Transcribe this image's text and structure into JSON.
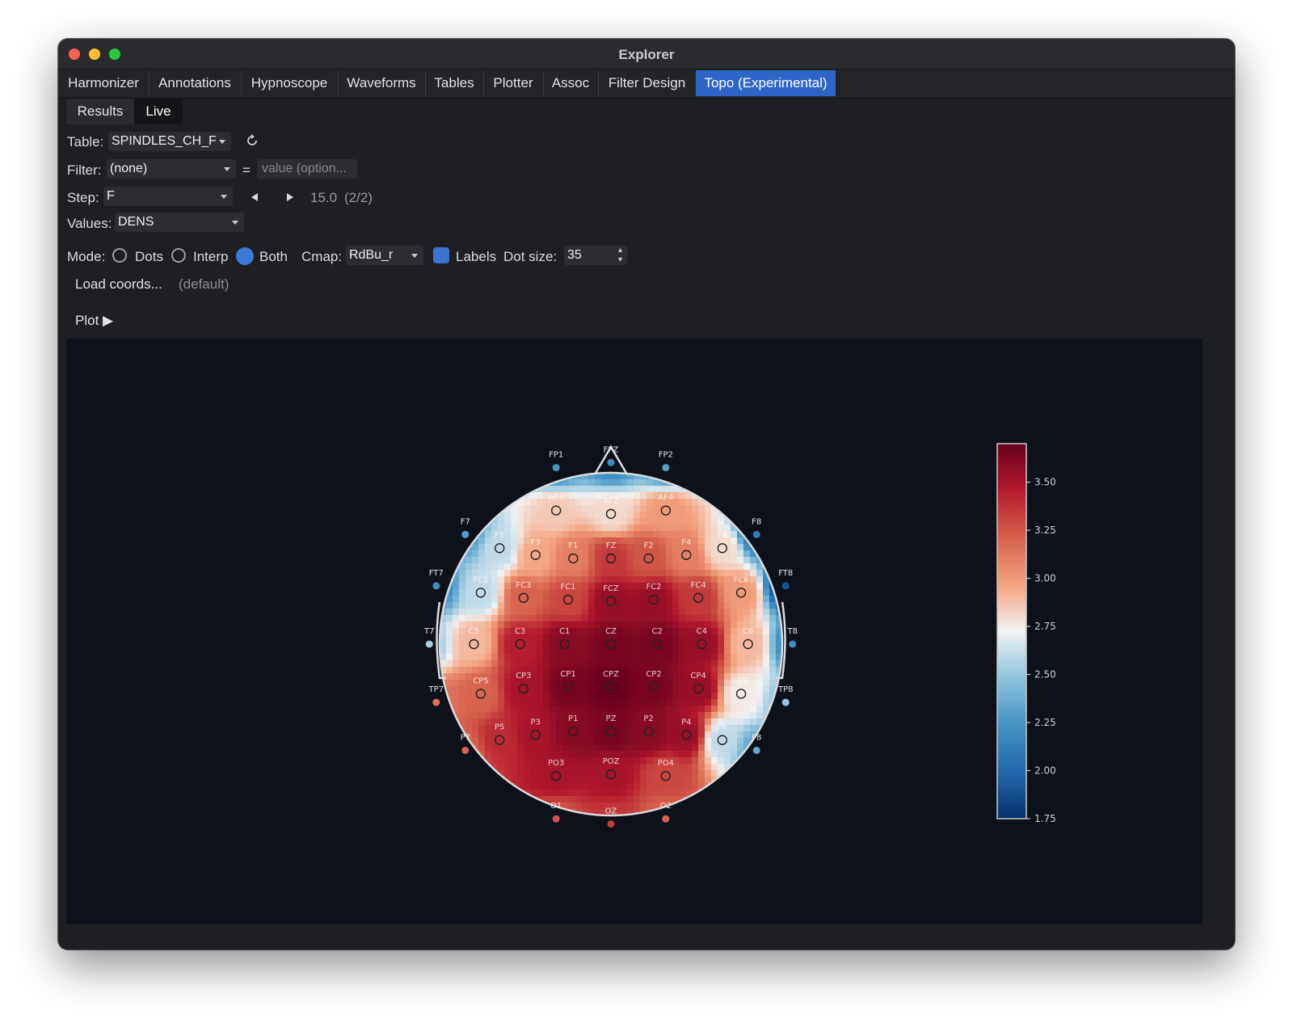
{
  "window": {
    "title": "Explorer"
  },
  "tabs": [
    {
      "label": "Harmonizer"
    },
    {
      "label": "Annotations"
    },
    {
      "label": "Hypnoscope"
    },
    {
      "label": "Waveforms"
    },
    {
      "label": "Tables"
    },
    {
      "label": "Plotter"
    },
    {
      "label": "Assoc"
    },
    {
      "label": "Filter Design"
    },
    {
      "label": "Topo (Experimental)",
      "active": true
    }
  ],
  "subtabs": [
    {
      "label": "Results"
    },
    {
      "label": "Live",
      "active": true
    }
  ],
  "controls": {
    "table_label": "Table:",
    "table_value": "SPINDLES_CH_F",
    "refresh_icon": "refresh-icon",
    "filter_label": "Filter:",
    "filter_value": "(none)",
    "equals": "=",
    "filter_placeholder": "value (option...",
    "step_label": "Step:",
    "step_value": "F",
    "step_prev_icon": "triangle-left-icon",
    "step_next_icon": "triangle-right-icon",
    "step_readout": "15.0",
    "step_index": "(2/2)",
    "values_label": "Values:",
    "values_value": "DENS",
    "mode_label": "Mode:",
    "mode_options": [
      "Dots",
      "Interp",
      "Both"
    ],
    "mode_selected": "Both",
    "cmap_label": "Cmap:",
    "cmap_value": "RdBu_r",
    "labels_label": "Labels",
    "labels_checked": true,
    "dotsize_label": "Dot size:",
    "dotsize_value": "35",
    "load_coords": "Load coords...",
    "coords_status": "(default)",
    "plot_button": "Plot ▶"
  },
  "chart_data": {
    "type": "heatmap",
    "title": "",
    "subtitle": "",
    "colormap": "RdBu_r",
    "value_range": [
      1.75,
      3.7
    ],
    "colorbar_ticks": [
      "3.50",
      "3.25",
      "3.00",
      "2.75",
      "2.50",
      "2.25",
      "2.00",
      "1.75"
    ],
    "colorbar_tick_values": [
      3.5,
      3.25,
      3.0,
      2.75,
      2.5,
      2.25,
      2.0,
      1.75
    ],
    "channels": [
      {
        "name": "FP1",
        "value": 2.25
      },
      {
        "name": "FPZ",
        "value": 2.2
      },
      {
        "name": "FP2",
        "value": 2.3
      },
      {
        "name": "AF3",
        "value": 2.85
      },
      {
        "name": "AFZ",
        "value": 2.8
      },
      {
        "name": "AF4",
        "value": 3.0
      },
      {
        "name": "F7",
        "value": 2.3
      },
      {
        "name": "F5",
        "value": 2.6
      },
      {
        "name": "F3",
        "value": 2.95
      },
      {
        "name": "F1",
        "value": 3.1
      },
      {
        "name": "FZ",
        "value": 3.35
      },
      {
        "name": "F2",
        "value": 3.25
      },
      {
        "name": "F4",
        "value": 3.1
      },
      {
        "name": "F6",
        "value": 2.8
      },
      {
        "name": "F8",
        "value": 2.1
      },
      {
        "name": "FT7",
        "value": 2.2
      },
      {
        "name": "FC5",
        "value": 2.6
      },
      {
        "name": "FC3",
        "value": 3.2
      },
      {
        "name": "FC1",
        "value": 3.3
      },
      {
        "name": "FCZ",
        "value": 3.55
      },
      {
        "name": "FC2",
        "value": 3.55
      },
      {
        "name": "FC4",
        "value": 3.35
      },
      {
        "name": "FC6",
        "value": 3.0
      },
      {
        "name": "FT8",
        "value": 1.9
      },
      {
        "name": "T7",
        "value": 2.55
      },
      {
        "name": "C5",
        "value": 2.9
      },
      {
        "name": "C3",
        "value": 3.45
      },
      {
        "name": "C1",
        "value": 3.6
      },
      {
        "name": "CZ",
        "value": 3.65
      },
      {
        "name": "C2",
        "value": 3.65
      },
      {
        "name": "C4",
        "value": 3.55
      },
      {
        "name": "C6",
        "value": 2.9
      },
      {
        "name": "T8",
        "value": 2.2
      },
      {
        "name": "TP7",
        "value": 3.15
      },
      {
        "name": "CP5",
        "value": 3.2
      },
      {
        "name": "CP3",
        "value": 3.5
      },
      {
        "name": "CP1",
        "value": 3.65
      },
      {
        "name": "CPZ",
        "value": 3.7
      },
      {
        "name": "CP2",
        "value": 3.65
      },
      {
        "name": "CP4",
        "value": 3.55
      },
      {
        "name": "CP6",
        "value": 2.75
      },
      {
        "name": "TP8",
        "value": 2.5
      },
      {
        "name": "P7",
        "value": 3.2
      },
      {
        "name": "P5",
        "value": 3.4
      },
      {
        "name": "P3",
        "value": 3.5
      },
      {
        "name": "P1",
        "value": 3.6
      },
      {
        "name": "PZ",
        "value": 3.65
      },
      {
        "name": "P2",
        "value": 3.6
      },
      {
        "name": "P4",
        "value": 3.55
      },
      {
        "name": "P6",
        "value": 2.6
      },
      {
        "name": "P8",
        "value": 2.35
      },
      {
        "name": "PO3",
        "value": 3.5
      },
      {
        "name": "POZ",
        "value": 3.5
      },
      {
        "name": "PO4",
        "value": 3.3
      },
      {
        "name": "O1",
        "value": 3.25
      },
      {
        "name": "OZ",
        "value": 3.35
      },
      {
        "name": "O2",
        "value": 3.2
      }
    ]
  }
}
